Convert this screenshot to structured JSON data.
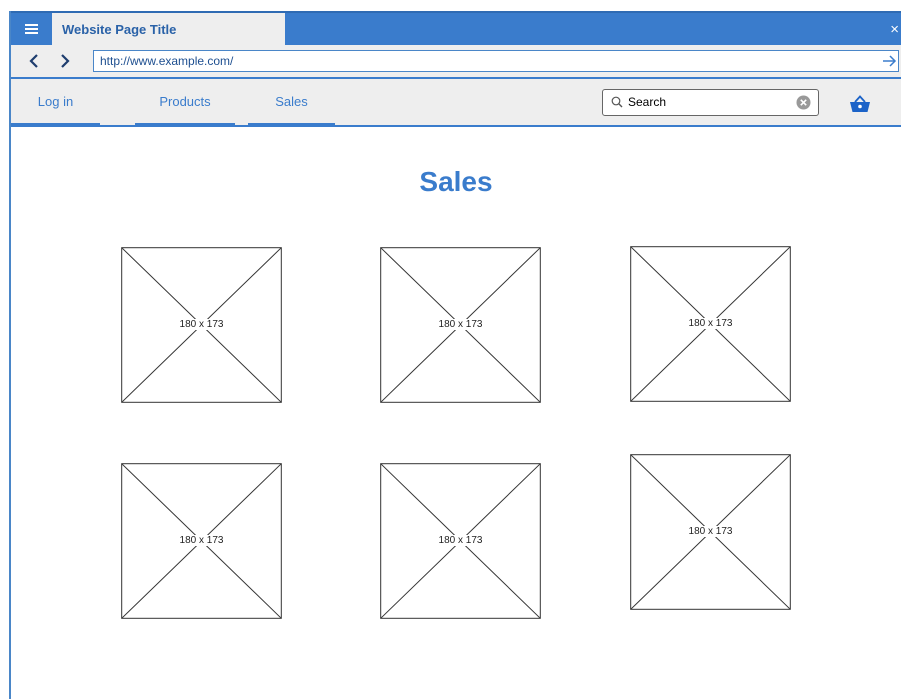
{
  "window": {
    "tab_title": "Website Page Title",
    "close_glyph": "×"
  },
  "address_bar": {
    "url": "http://www.example.com/"
  },
  "nav": {
    "links": [
      "Log in",
      "Products",
      "Sales"
    ]
  },
  "search": {
    "value": "Search"
  },
  "main": {
    "title": "Sales",
    "placeholders": [
      {
        "label": "180 x 173"
      },
      {
        "label": "180 x 173"
      },
      {
        "label": "180 x 173"
      },
      {
        "label": "180 x 173"
      },
      {
        "label": "180 x 173"
      },
      {
        "label": "180 x 173"
      }
    ]
  },
  "icons": {
    "menu": "hamburger-menu-icon",
    "back": "chevron-left-icon",
    "forward": "chevron-right-icon",
    "go": "arrow-right-icon",
    "search": "search-icon",
    "clear": "clear-icon",
    "cart": "shopping-basket-icon",
    "close": "close-icon"
  },
  "colors": {
    "accent": "#3a7ccc",
    "chrome_bg": "#eeeeee",
    "page_bg": "#ffffff"
  }
}
